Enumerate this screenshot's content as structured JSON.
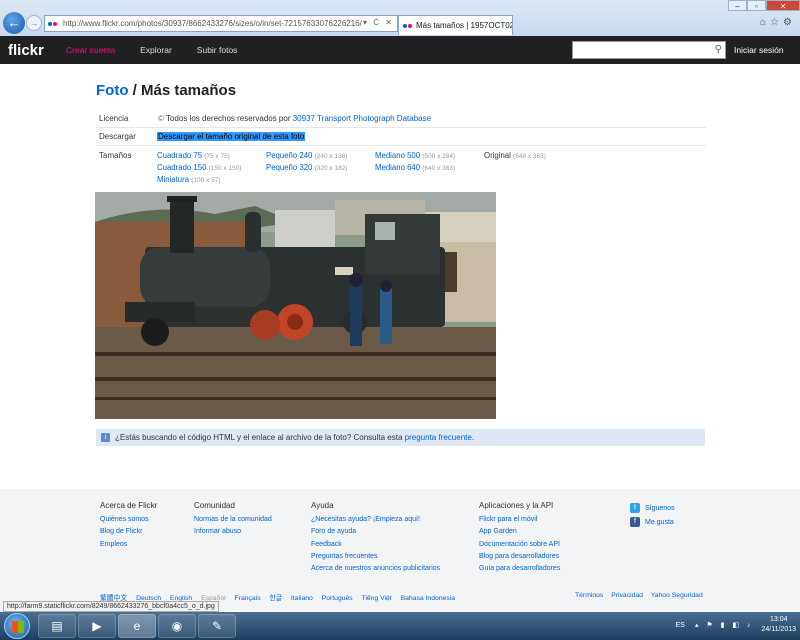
{
  "browser": {
    "url": "http://www.flickr.com/photos/30937/8662433276/sizes/o/in/set-72157633076226216/",
    "tab_title": "Más tamaños | 1957OCT02...",
    "url_tools": "▾ C ✕",
    "ie_icons": "⌂☆⚙"
  },
  "header": {
    "logo": "flickr",
    "nav": [
      "Crear cuenta",
      "Explorar",
      "Subir fotos"
    ],
    "search_placeholder": "",
    "signin": "Iniciar sesión"
  },
  "page": {
    "title_link": "Foto",
    "title_sep": " / ",
    "title_rest": "Más tamaños"
  },
  "rows": {
    "license_label": "Licencia",
    "license_prefix": "Todos los derechos reservados por",
    "license_owner": "30937 Transport Photograph Database",
    "download_label": "Descargar",
    "download_link": "Descargar el tamaño original de esta foto",
    "sizes_label": "Tamaños"
  },
  "sizes": [
    {
      "name": "Cuadrado 75",
      "dim": "(75 x 75)"
    },
    {
      "name": "Cuadrado 150",
      "dim": "(150 x 150)"
    },
    {
      "name": "Miniatura",
      "dim": "(100 x 57)"
    },
    {
      "name": "Pequeño 240",
      "dim": "(240 x 136)"
    },
    {
      "name": "Pequeño 320",
      "dim": "(320 x 182)"
    },
    {
      "name": "Mediano 500",
      "dim": "(500 x 284)"
    },
    {
      "name": "Mediano 640",
      "dim": "(640 x 363)"
    },
    {
      "name": "Original",
      "dim": "(648 x 363)"
    }
  ],
  "hint": {
    "text": "¿Estás buscando el código HTML y el enlace al archivo de la foto? Consulta esta",
    "link": "pregunta frecuente",
    "end": "."
  },
  "footer": {
    "col1": {
      "title": "Acerca de Flickr",
      "links": [
        "Quiénes somos",
        "Blog de Flickr",
        "Empleos"
      ]
    },
    "col2": {
      "title": "Comunidad",
      "links": [
        "Normas de la comunidad",
        "Informar abuso"
      ]
    },
    "col3": {
      "title": "Ayuda",
      "links": [
        "¿Necesitas ayuda? ¡Empieza aquí!",
        "Foro de ayuda",
        "Feedback",
        "Preguntas frecuentes",
        "Acerca de nuestros anuncios publicitarios"
      ]
    },
    "col4": {
      "title": "Aplicaciones y la API",
      "links": [
        "Flickr para el móvil",
        "App Garden",
        "Documentación sobre API",
        "Blog para desarrolladores",
        "Guía para desarrolladores"
      ]
    },
    "social": [
      "Síguenos",
      "Me gusta"
    ],
    "langs": [
      "繁體中文",
      "Deutsch",
      "English",
      "Español",
      "Français",
      "한글",
      "Italiano",
      "Português",
      "Tiếng Việt",
      "Bahasa Indonesia"
    ],
    "links": [
      "Términos",
      "Privacidad",
      "Yahoo Seguridad"
    ]
  },
  "status_url": "http://farm9.staticflickr.com/8249/8662433276_bbcf0a4cc5_o_d.jpg",
  "taskbar": {
    "lang": "ES",
    "time": "13:04",
    "date": "24/11/2013"
  },
  "colors": {
    "accent": "#0063dc",
    "pink": "#ff0084",
    "header_bg": "#212124"
  }
}
